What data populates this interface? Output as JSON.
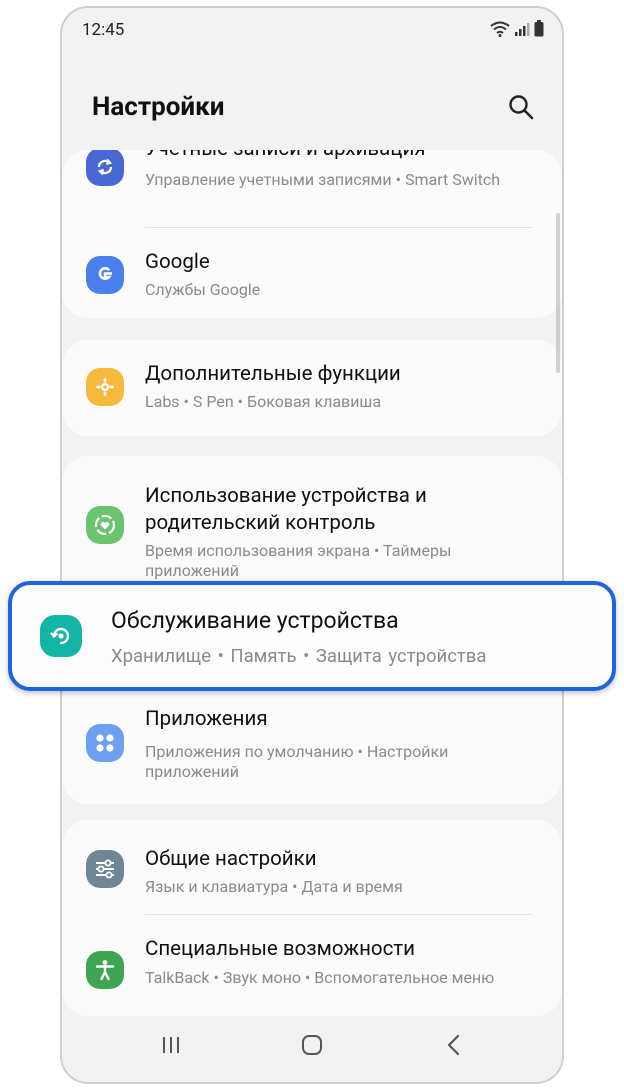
{
  "status": {
    "time": "12:45"
  },
  "header": {
    "title": "Настройки"
  },
  "items": [
    {
      "title": "Учетные записи и архивация",
      "subtitle": "Управление учетными записями • Smart Switch"
    },
    {
      "title": "Google",
      "subtitle": "Службы Google"
    },
    {
      "title": "Дополнительные функции",
      "subtitle": "Labs • S Pen • Боковая клавиша"
    },
    {
      "title": "Использование устройства и родительский контроль",
      "subtitle": "Время использования экрана • Таймеры приложений"
    },
    {
      "title": "Обслуживание устройства",
      "subtitle": "Хранилище • Память • Защита устройства"
    },
    {
      "title": "Приложения",
      "subtitle": "Приложения по умолчанию • Настройки приложений"
    },
    {
      "title": "Общие настройки",
      "subtitle": "Язык и клавиатура • Дата и время"
    },
    {
      "title": "Специальные возможности",
      "subtitle": "TalkBack • Звук моно • Вспомогательное меню"
    }
  ],
  "icons": [
    {
      "name": "accounts-sync-icon",
      "color": "#4a67d6"
    },
    {
      "name": "google-icon",
      "color": "#4a7fee"
    },
    {
      "name": "advanced-features-icon",
      "color": "#f6b93b"
    },
    {
      "name": "digital-wellbeing-icon",
      "color": "#6cc46e"
    },
    {
      "name": "device-care-icon",
      "color": "#13b5a6"
    },
    {
      "name": "apps-icon",
      "color": "#6fa0f0"
    },
    {
      "name": "general-settings-icon",
      "color": "#6f8694"
    },
    {
      "name": "accessibility-icon",
      "color": "#3fa552"
    }
  ],
  "highlight_color": "#1f64dc"
}
